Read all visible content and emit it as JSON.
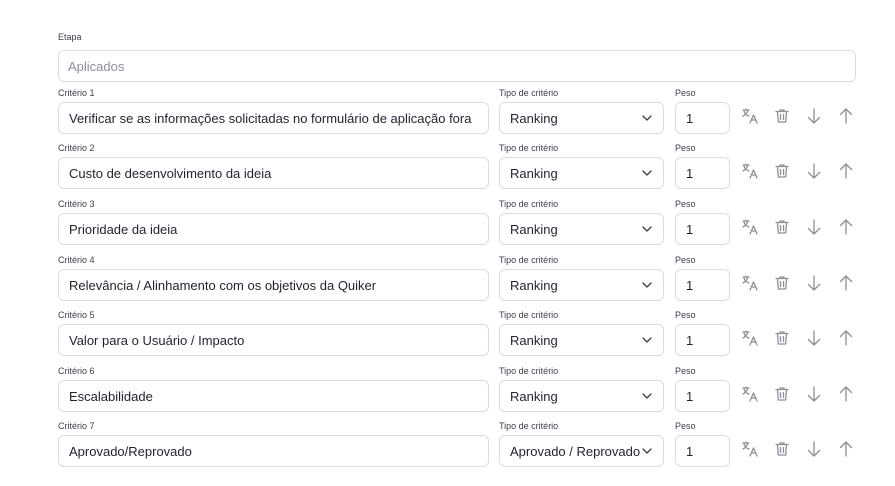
{
  "stage": {
    "label": "Etapa",
    "placeholder": "Aplicados"
  },
  "labels": {
    "type": "Tipo de critério",
    "weight": "Peso"
  },
  "criteria": [
    {
      "label": "Critério 1",
      "value": "Verificar se as informações solicitadas no formulário de aplicação fora",
      "type": "Ranking",
      "weight": "1"
    },
    {
      "label": "Critério 2",
      "value": "Custo de desenvolvimento da ideia",
      "type": "Ranking",
      "weight": "1"
    },
    {
      "label": "Critério 3",
      "value": "Prioridade da ideia",
      "type": "Ranking",
      "weight": "1"
    },
    {
      "label": "Critério 4",
      "value": "Relevância / Alinhamento com os objetivos da Quiker",
      "type": "Ranking",
      "weight": "1"
    },
    {
      "label": "Critério 5",
      "value": "Valor para o Usuário / Impacto",
      "type": "Ranking",
      "weight": "1"
    },
    {
      "label": "Critério 6",
      "value": "Escalabilidade",
      "type": "Ranking",
      "weight": "1"
    },
    {
      "label": "Critério 7",
      "value": "Aprovado/Reprovado",
      "type": "Aprovado / Reprovado",
      "weight": "1"
    }
  ],
  "icons": [
    "translate-icon",
    "trash-icon",
    "arrow-down-icon",
    "arrow-up-icon"
  ],
  "colors": {
    "border": "#d9dde3",
    "icon": "#8a8f99",
    "text": "#1f2330"
  }
}
